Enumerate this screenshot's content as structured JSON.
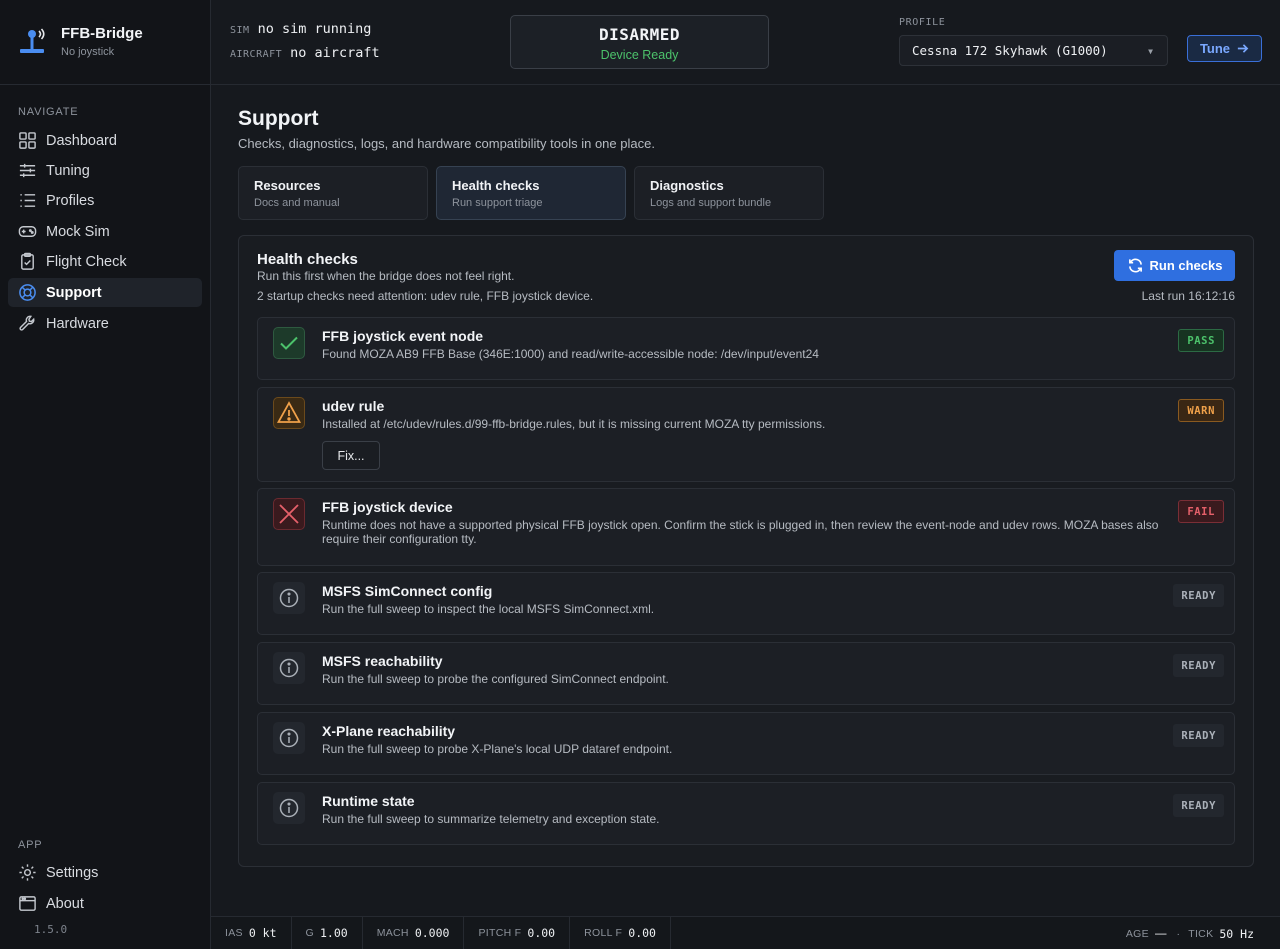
{
  "app": {
    "title": "FFB-Bridge",
    "subtitle": "No joystick",
    "version": "1.5.0"
  },
  "sidebar": {
    "navigate_label": "NAVIGATE",
    "items": [
      {
        "label": "Dashboard",
        "icon": "dashboard-icon"
      },
      {
        "label": "Tuning",
        "icon": "sliders-icon"
      },
      {
        "label": "Profiles",
        "icon": "list-icon"
      },
      {
        "label": "Mock Sim",
        "icon": "gamepad-icon"
      },
      {
        "label": "Flight Check",
        "icon": "clipboard-check-icon"
      },
      {
        "label": "Support",
        "icon": "lifebuoy-icon",
        "active": true
      },
      {
        "label": "Hardware",
        "icon": "wrench-icon"
      }
    ],
    "app_label": "APP",
    "app_items": [
      {
        "label": "Settings",
        "icon": "gear-icon"
      },
      {
        "label": "About",
        "icon": "window-icon"
      }
    ]
  },
  "topbar": {
    "sim_key": "SIM",
    "sim_value": "no sim running",
    "aircraft_key": "AIRCRAFT",
    "aircraft_value": "no aircraft",
    "arm_state": "DISARMED",
    "arm_sub": "Device Ready",
    "profile_label": "PROFILE",
    "profile_value": "Cessna 172 Skyhawk (G1000)",
    "tune_label": "Tune"
  },
  "page": {
    "title": "Support",
    "subtitle": "Checks, diagnostics, logs, and hardware compatibility tools in one place.",
    "tabs": [
      {
        "title": "Resources",
        "sub": "Docs and manual"
      },
      {
        "title": "Health checks",
        "sub": "Run support triage",
        "active": true
      },
      {
        "title": "Diagnostics",
        "sub": "Logs and support bundle"
      }
    ]
  },
  "health": {
    "title": "Health checks",
    "subtitle": "Run this first when the bridge does not feel right.",
    "note": "2 startup checks need attention: udev rule, FFB joystick device.",
    "run_label": "Run checks",
    "last_run": "Last run 16:12:16",
    "fix_label": "Fix...",
    "checks": [
      {
        "title": "FFB joystick event node",
        "desc": "Found MOZA AB9 FFB Base (346E:1000) and read/write-accessible node: /dev/input/event24",
        "status": "PASS"
      },
      {
        "title": "udev rule",
        "desc": "Installed at /etc/udev/rules.d/99-ffb-bridge.rules, but it is missing current MOZA tty permissions.",
        "status": "WARN"
      },
      {
        "title": "FFB joystick device",
        "desc": "Runtime does not have a supported physical FFB joystick open. Confirm the stick is plugged in, then review the event-node and udev rows. MOZA bases also require their configuration tty.",
        "status": "FAIL"
      },
      {
        "title": "MSFS SimConnect config",
        "desc": "Run the full sweep to inspect the local MSFS SimConnect.xml.",
        "status": "READY"
      },
      {
        "title": "MSFS reachability",
        "desc": "Run the full sweep to probe the configured SimConnect endpoint.",
        "status": "READY"
      },
      {
        "title": "X-Plane reachability",
        "desc": "Run the full sweep to probe X-Plane's local UDP dataref endpoint.",
        "status": "READY"
      },
      {
        "title": "Runtime state",
        "desc": "Run the full sweep to summarize telemetry and exception state.",
        "status": "READY"
      }
    ]
  },
  "statusbar": {
    "items": [
      {
        "key": "IAS",
        "value": "0 kt"
      },
      {
        "key": "G",
        "value": "1.00"
      },
      {
        "key": "MACH",
        "value": "0.000"
      },
      {
        "key": "PITCH F",
        "value": "0.00"
      },
      {
        "key": "ROLL F",
        "value": "0.00"
      }
    ],
    "age_key": "AGE",
    "age_value": "—",
    "sep": "·",
    "tick_key": "TICK",
    "tick_value": "50 Hz"
  },
  "colors": {
    "accent": "#2f6fe0",
    "pass": "#4cc26b",
    "warn": "#f0a14a",
    "fail": "#e5606a"
  }
}
